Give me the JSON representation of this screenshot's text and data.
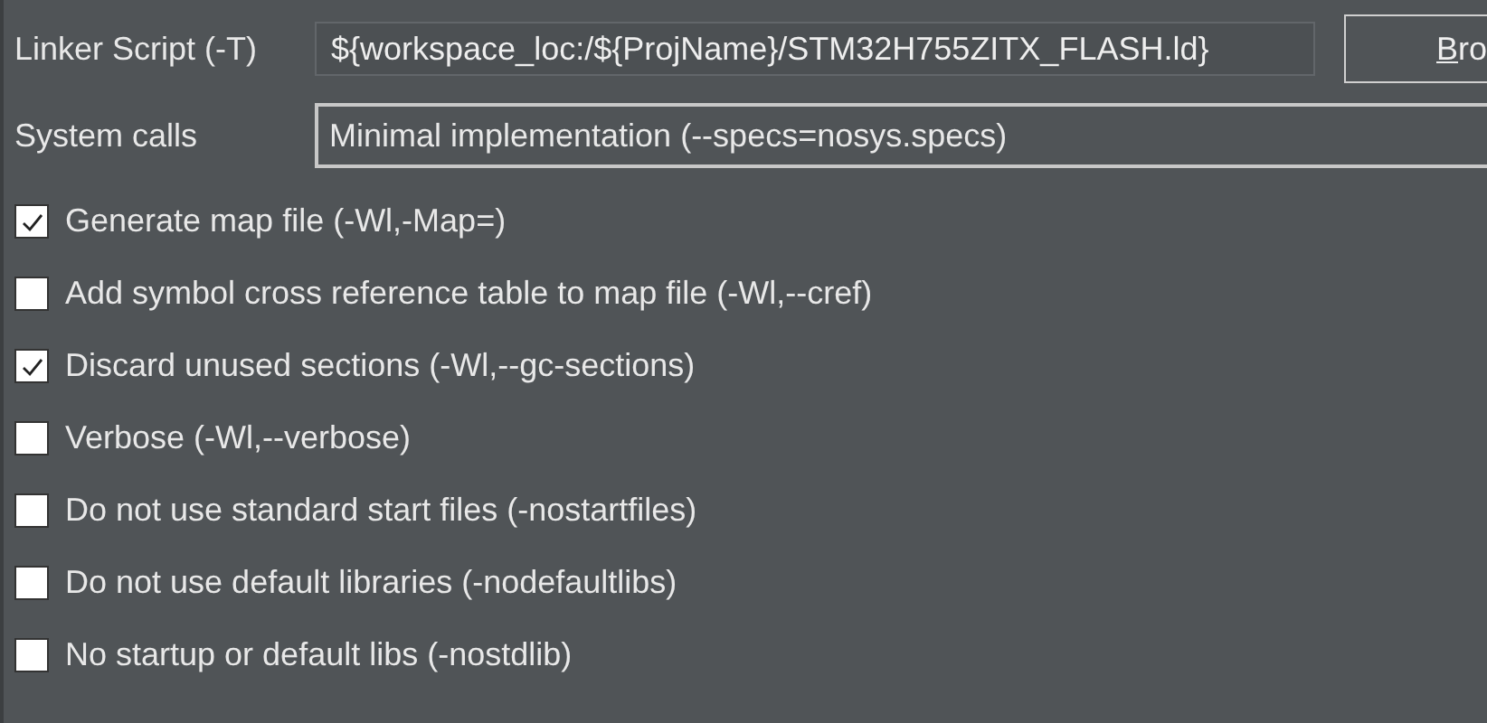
{
  "linker_script": {
    "label": "Linker Script (-T)",
    "value": "${workspace_loc:/${ProjName}/STM32H755ZITX_FLASH.ld}",
    "button": "Bro"
  },
  "system_calls": {
    "label": "System calls",
    "value": "Minimal implementation (--specs=nosys.specs)"
  },
  "options": [
    {
      "label": "Generate map file (-Wl,-Map=)",
      "checked": true
    },
    {
      "label": "Add symbol cross reference table to map file (-Wl,--cref)",
      "checked": false
    },
    {
      "label": "Discard unused sections (-Wl,--gc-sections)",
      "checked": true
    },
    {
      "label": "Verbose (-Wl,--verbose)",
      "checked": false
    },
    {
      "label": "Do not use standard start files (-nostartfiles)",
      "checked": false
    },
    {
      "label": "Do not use default libraries (-nodefaultlibs)",
      "checked": false
    },
    {
      "label": "No startup or default libs (-nostdlib)",
      "checked": false
    }
  ]
}
